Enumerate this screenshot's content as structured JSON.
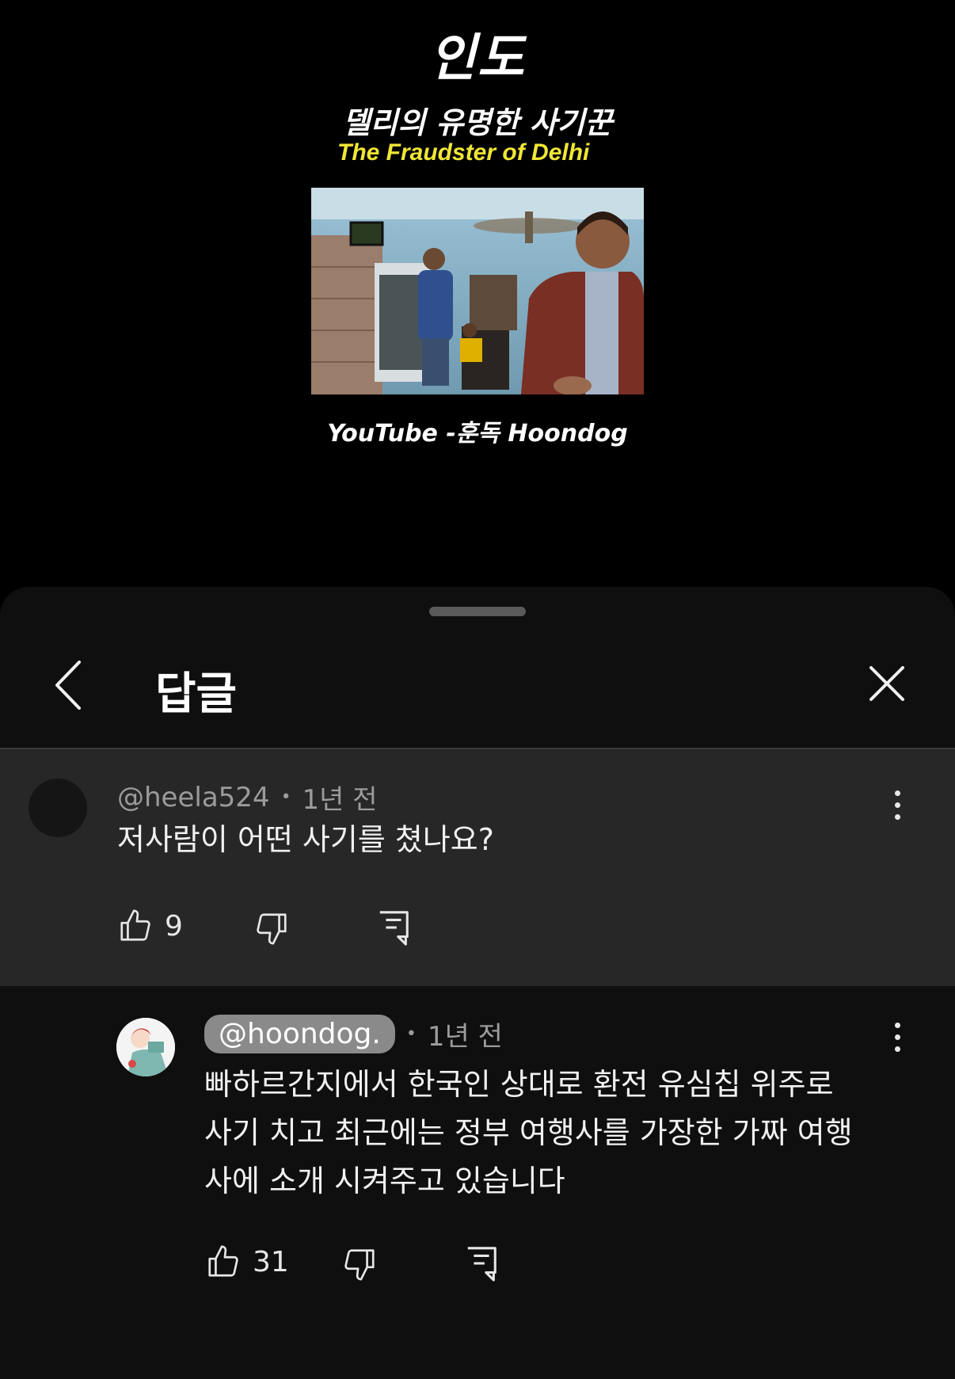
{
  "video": {
    "title_main": "인도",
    "title_sub": "델리의 유명한 사기꾼",
    "title_en": "The Fraudster of Delhi",
    "credit": "YouTube -훈독 Hoondog"
  },
  "sheet": {
    "title": "답글",
    "back_icon": "chevron-left-icon",
    "close_icon": "close-icon"
  },
  "parent_comment": {
    "author": "@heela524",
    "time": "1년 전",
    "text": "저사람이 어떤 사기를 쳤나요?",
    "likes": "9"
  },
  "reply": {
    "author": "@hoondog.",
    "time": "1년 전",
    "text_lines": [
      "빠하르간지에서 한국인 상대로 환전 유심칩 위주로",
      "사기 치고 최근에는 정부 여행사를 가장한 가짜 여행",
      "사에 소개 시켜주고 있습니다"
    ],
    "likes": "31"
  },
  "colors": {
    "background": "#000000",
    "sheet": "#0f0f0f",
    "highlight_comment": "#272727",
    "subtitle_yellow": "#f0e636",
    "author_chip": "#8a8a8a"
  }
}
